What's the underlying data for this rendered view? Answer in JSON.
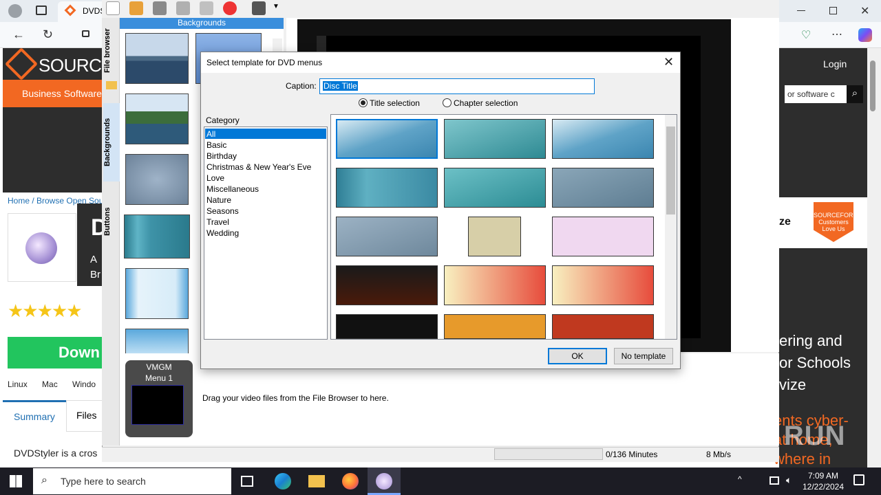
{
  "browser": {
    "tab_title": "DVDS",
    "toolbar_menu": "⋯"
  },
  "site": {
    "brand": "SOURCE",
    "business_link": "Business Software",
    "breadcrumb": "Home / Browse Open Sour",
    "title_initial": "D",
    "tagline_1": "A",
    "tagline_2": "Br",
    "stars": "★★★★★",
    "download": "Down",
    "platforms": "Linux Mac Windo",
    "tab_summary": "Summary",
    "tab_files": "Files",
    "summary_text": "DVDStyler is a cros",
    "login": "Login",
    "search_placeholder": "or software c",
    "ad_word": "ze",
    "ad_badge": "SOURCEFORGE Customers Love Us",
    "promo_1": [
      "ering and",
      "or Schools",
      "vize"
    ],
    "promo_2": [
      "ents cyber-",
      "at home,",
      "where in"
    ]
  },
  "app": {
    "panel_tabs": [
      "File browser",
      "Backgrounds",
      "Buttons"
    ],
    "backgrounds_header": "Backgrounds",
    "vmgm_label": "VMGM",
    "menu_label": "Menu 1",
    "drag_hint": "Drag your video files from the File Browser to here.",
    "minutes": "0/136 Minutes",
    "speed": "8 Mb/s"
  },
  "dialog": {
    "title": "Select template for DVD menus",
    "close": "✕",
    "caption_label": "Caption:",
    "caption_value": "Disc Title",
    "radio_title": "Title selection",
    "radio_chapter": "Chapter selection",
    "category_label": "Category",
    "categories": [
      "All",
      "Basic",
      "Birthday",
      "Christmas & New Year's Eve",
      "Love",
      "Miscellaneous",
      "Nature",
      "Seasons",
      "Travel",
      "Wedding"
    ],
    "ok": "OK",
    "no_template": "No template"
  },
  "taskbar": {
    "search_placeholder": "Type here to search",
    "time": "7:09 AM",
    "date": "12/22/2024"
  },
  "watermark": "ANY RUN",
  "colors": {
    "accent": "#0078d7",
    "sourceforge_orange": "#f26822",
    "download_green": "#22c55e"
  }
}
